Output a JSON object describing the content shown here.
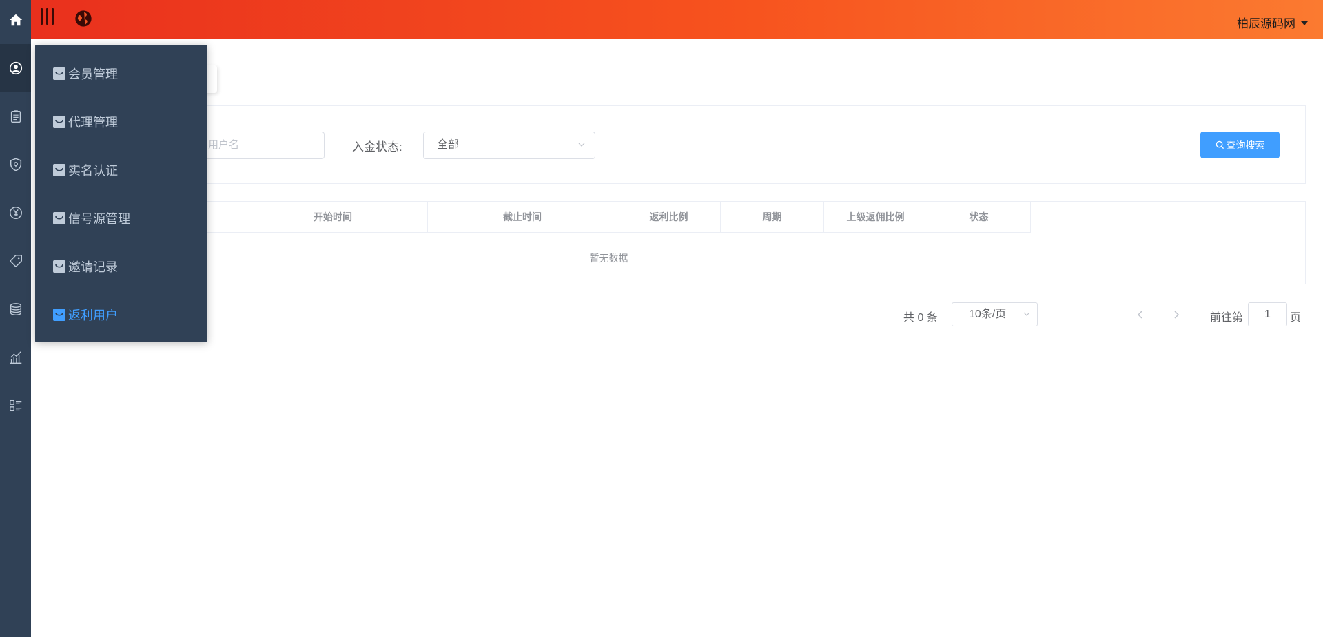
{
  "header": {
    "user_name": "柏辰源码网"
  },
  "rail": {
    "items": [
      {
        "icon": "home-icon"
      },
      {
        "icon": "user-circle-icon"
      },
      {
        "icon": "clipboard-icon"
      },
      {
        "icon": "shield-icon"
      },
      {
        "icon": "yen-icon"
      },
      {
        "icon": "tag-icon"
      },
      {
        "icon": "coins-icon"
      },
      {
        "icon": "chart-icon"
      },
      {
        "icon": "list-icon"
      }
    ]
  },
  "submenu": {
    "items": [
      {
        "label": "会员管理",
        "active": false
      },
      {
        "label": "代理管理",
        "active": false
      },
      {
        "label": "实名认证",
        "active": false
      },
      {
        "label": "信号源管理",
        "active": false
      },
      {
        "label": "邀请记录",
        "active": false
      },
      {
        "label": "返利用户",
        "active": true
      }
    ]
  },
  "search": {
    "username_placeholder": "用户名",
    "status_label": "入金状态:",
    "status_value": "全部",
    "button_label": "查询搜索"
  },
  "table": {
    "columns": [
      "开始时间",
      "截止时间",
      "返利比例",
      "周期",
      "上级返佣比例",
      "状态"
    ],
    "rows": [],
    "empty_text": "暂无数据"
  },
  "pagination": {
    "total_text": "共 0 条",
    "page_size": "10条/页",
    "goto_label": "前往第",
    "current_page": "1",
    "goto_suffix": "页"
  },
  "colors": {
    "sidebar": "#304156",
    "header_start": "#e9301d",
    "header_end": "#fb7a30",
    "primary": "#409eff"
  }
}
